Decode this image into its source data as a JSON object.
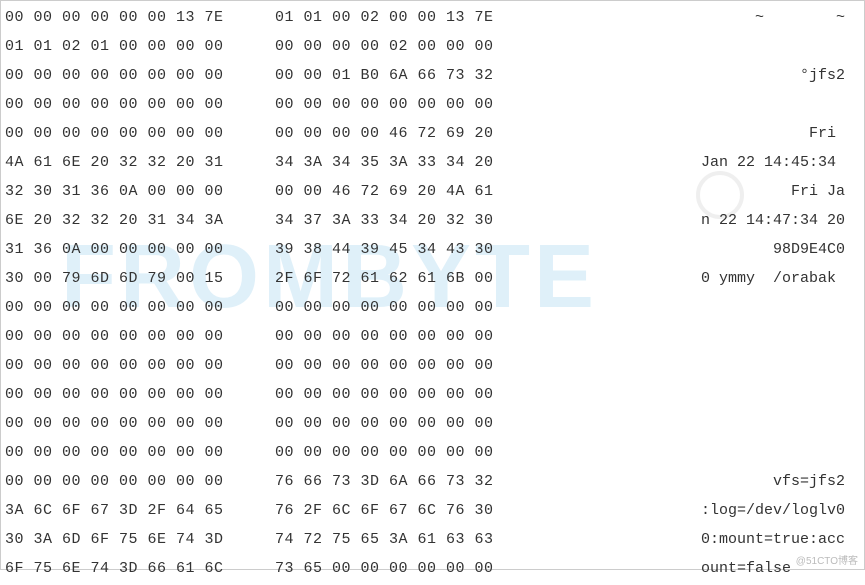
{
  "watermark": "FROMBYTE",
  "footer": "@51CTO博客",
  "rows": [
    {
      "l": "00 00 00 00 00 00 13 7E",
      "r": "01 01 00 02 00 00 13 7E",
      "a": "       ~        ~"
    },
    {
      "l": "01 01 02 01 00 00 00 00",
      "r": "00 00 00 00 02 00 00 00",
      "a": ""
    },
    {
      "l": "00 00 00 00 00 00 00 00",
      "r": "00 00 01 B0 6A 66 73 32",
      "a": "           °jfs2"
    },
    {
      "l": "00 00 00 00 00 00 00 00",
      "r": "00 00 00 00 00 00 00 00",
      "a": ""
    },
    {
      "l": "00 00 00 00 00 00 00 00",
      "r": "00 00 00 00 46 72 69 20",
      "a": "            Fri "
    },
    {
      "l": "4A 61 6E 20 32 32 20 31",
      "r": "34 3A 34 35 3A 33 34 20",
      "a": "Jan 22 14:45:34 "
    },
    {
      "l": "32 30 31 36 0A 00 00 00",
      "r": "00 00 46 72 69 20 4A 61",
      "a": "          Fri Ja"
    },
    {
      "l": "6E 20 32 32 20 31 34 3A",
      "r": "34 37 3A 33 34 20 32 30",
      "a": "n 22 14:47:34 20"
    },
    {
      "l": "31 36 0A 00 00 00 00 00",
      "r": "39 38 44 39 45 34 43 30",
      "a": "        98D9E4C0"
    },
    {
      "l": "30 00 79 6D 6D 79 00 15",
      "r": "2F 6F 72 61 62 61 6B 00",
      "a": "0 ymmy  /orabak "
    },
    {
      "l": "00 00 00 00 00 00 00 00",
      "r": "00 00 00 00 00 00 00 00",
      "a": ""
    },
    {
      "l": "00 00 00 00 00 00 00 00",
      "r": "00 00 00 00 00 00 00 00",
      "a": ""
    },
    {
      "l": "00 00 00 00 00 00 00 00",
      "r": "00 00 00 00 00 00 00 00",
      "a": ""
    },
    {
      "l": "00 00 00 00 00 00 00 00",
      "r": "00 00 00 00 00 00 00 00",
      "a": ""
    },
    {
      "l": "00 00 00 00 00 00 00 00",
      "r": "00 00 00 00 00 00 00 00",
      "a": ""
    },
    {
      "l": "00 00 00 00 00 00 00 00",
      "r": "00 00 00 00 00 00 00 00",
      "a": ""
    },
    {
      "l": "00 00 00 00 00 00 00 00",
      "r": "76 66 73 3D 6A 66 73 32",
      "a": "        vfs=jfs2"
    },
    {
      "l": "3A 6C 6F 67 3D 2F 64 65",
      "r": "76 2F 6C 6F 67 6C 76 30",
      "a": ":log=/dev/loglv0"
    },
    {
      "l": "30 3A 6D 6F 75 6E 74 3D",
      "r": "74 72 75 65 3A 61 63 63",
      "a": "0:mount=true:acc"
    },
    {
      "l": "6F 75 6E 74 3D 66 61 6C",
      "r": "73 65 00 00 00 00 00 00",
      "a": "ount=false      "
    }
  ]
}
